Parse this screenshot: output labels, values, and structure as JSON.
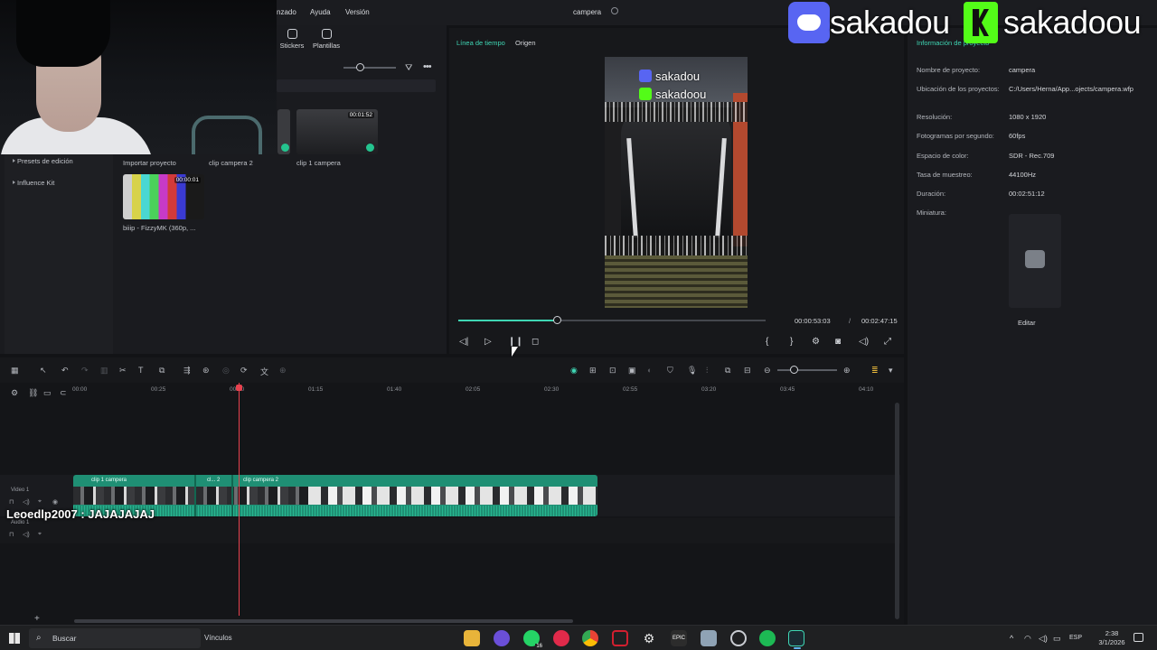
{
  "menubar": {
    "items": [
      "nzado",
      "Ayuda",
      "Versión"
    ],
    "title": "campera"
  },
  "media": {
    "tabs": [
      {
        "label": "Stickers"
      },
      {
        "label": "Plantillas"
      }
    ],
    "sidebar": [
      {
        "label": "Presets de edición"
      },
      {
        "label": "Influence Kit"
      }
    ],
    "cards": [
      {
        "label": "Importar proyecto",
        "duration": ""
      },
      {
        "label": "clip campera 2",
        "duration": ""
      },
      {
        "label": "clip 1 campera",
        "duration": "00:01:52"
      },
      {
        "label": "biiip - FizzyMK (360p, ...",
        "duration": "00:00:01"
      }
    ]
  },
  "preview": {
    "tabs": [
      {
        "label": "Línea de tiempo",
        "color": "#3fd6b4"
      },
      {
        "label": "Origen",
        "color": "#d4d6da"
      }
    ],
    "overlay_discord": "sakadou",
    "overlay_kick": "sakadoou",
    "current_time": "00:00:53:03",
    "separator": "/",
    "total_time": "00:02:47:15",
    "progress": 0.32
  },
  "properties": {
    "header": "Información de proyecto",
    "rows": [
      {
        "label": "Nombre de proyecto:",
        "value": "campera"
      },
      {
        "label": "Ubicación de los proyectos:",
        "value": "C:/Users/Herna/App...ojects/campera.wfp"
      },
      {
        "label": "Resolución:",
        "value": "1080 x 1920"
      },
      {
        "label": "Fotogramas por segundo:",
        "value": "60fps"
      },
      {
        "label": "Espacio de color:",
        "value": "SDR - Rec.709"
      },
      {
        "label": "Tasa de muestreo:",
        "value": "44100Hz"
      },
      {
        "label": "Duración:",
        "value": "00:02:51:12"
      },
      {
        "label": "Miniatura:",
        "value": ""
      }
    ],
    "edit_label": "Editar"
  },
  "stream_overlay": {
    "discord_name": "sakadou",
    "kick_name": "sakadoou"
  },
  "timeline": {
    "ruler": [
      "00:00",
      "00:25",
      "00:50",
      "01:15",
      "01:40",
      "02:05",
      "02:30",
      "02:55",
      "03:20",
      "03:45",
      "04:10"
    ],
    "video_track_label": "Video 1",
    "audio_track_label": "Audio 1",
    "clips": [
      {
        "title": "clip 1 campera"
      },
      {
        "title": "cl... 2"
      },
      {
        "title": "clip campera 2"
      }
    ],
    "chat_overlay": "Leoedlp2007 : JAJAJAJAJ",
    "add_track": "+"
  },
  "taskbar": {
    "search_placeholder": "Buscar",
    "links_label": "Vínculos",
    "lang": "ESP",
    "time": "2:38",
    "date": "3/1/2026",
    "whatsapp_badge": "16"
  },
  "colors": {
    "accent": "#3fd6b4",
    "clip": "#1f8f74",
    "playhead": "#e8424f",
    "discord": "#5865f2",
    "kick": "#53fc18"
  }
}
